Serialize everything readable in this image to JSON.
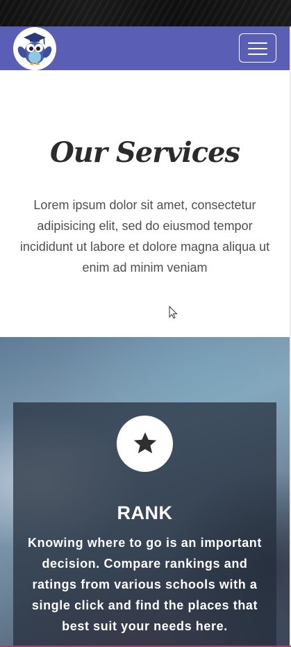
{
  "header": {
    "logo_icon": "owl-graduate-icon",
    "menu_icon": "hamburger-icon"
  },
  "intro": {
    "title": "Our Services",
    "text": "Lorem ipsum dolor sit amet, consectetur adipisicing elit, sed do eiusmod tempor incididunt ut labore et dolore magna aliqua ut enim ad minim veniam"
  },
  "services": {
    "items": [
      {
        "icon": "star-icon",
        "title": "RANK",
        "text": "Knowing where to go is an important decision. Compare rankings and ratings from various schools with a single click and find the places that best suit your needs here."
      }
    ]
  },
  "colors": {
    "navbar": "#5b5eb5",
    "title": "#2b2b2b",
    "body_text": "#4f4f4f",
    "card_overlay": "#222c3a",
    "accent_line": "#b03d6e"
  }
}
